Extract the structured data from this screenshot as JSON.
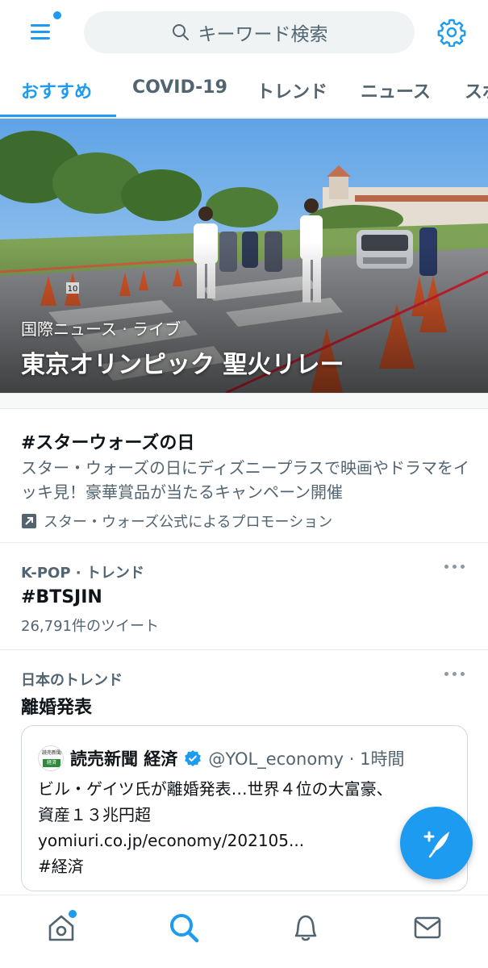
{
  "search": {
    "placeholder": "キーワード検索"
  },
  "tabs": [
    {
      "label": "おすすめ",
      "active": true
    },
    {
      "label": "COVID-19",
      "active": false
    },
    {
      "label": "トレンド",
      "active": false
    },
    {
      "label": "ニュース",
      "active": false
    },
    {
      "label": "スポ",
      "active": false
    }
  ],
  "hero": {
    "subtitle": "国際ニュース · ライブ",
    "title": "東京オリンピック 聖火リレー",
    "cone_number": "10"
  },
  "trends": {
    "promo": {
      "title": "#スターウォーズの日",
      "description": "スター・ウォーズの日にディズニープラスで映画やドラマをイッキ見！豪華賞品が当たるキャンペーン開催",
      "promoted_by": "スター・ウォーズ公式によるプロモーション"
    },
    "item1": {
      "meta": "K-POP · トレンド",
      "name": "#BTSJIN",
      "count": "26,791件のツイート"
    },
    "item2": {
      "meta": "日本のトレンド",
      "name": "離婚発表",
      "tweet": {
        "avatar_text": "読売新聞",
        "avatar_sub": "経済",
        "author": "読売新聞 経済",
        "handle": "@YOL_economy · 1時間",
        "line1": "ビル・ゲイツ氏が離婚発表…世界４位の大富豪、",
        "line2": "資産１３兆円超",
        "line3": "yomiuri.co.jp/economy/202105...",
        "line4": "#経済"
      }
    }
  },
  "colors": {
    "accent": "#1d9bf0",
    "text": "#0f1419",
    "secondary": "#536471"
  },
  "icons": [
    "menu-icon",
    "search-icon",
    "gear-icon",
    "promoted-icon",
    "more-icon",
    "verified-icon",
    "compose-icon",
    "home-icon",
    "bell-icon",
    "mail-icon"
  ]
}
